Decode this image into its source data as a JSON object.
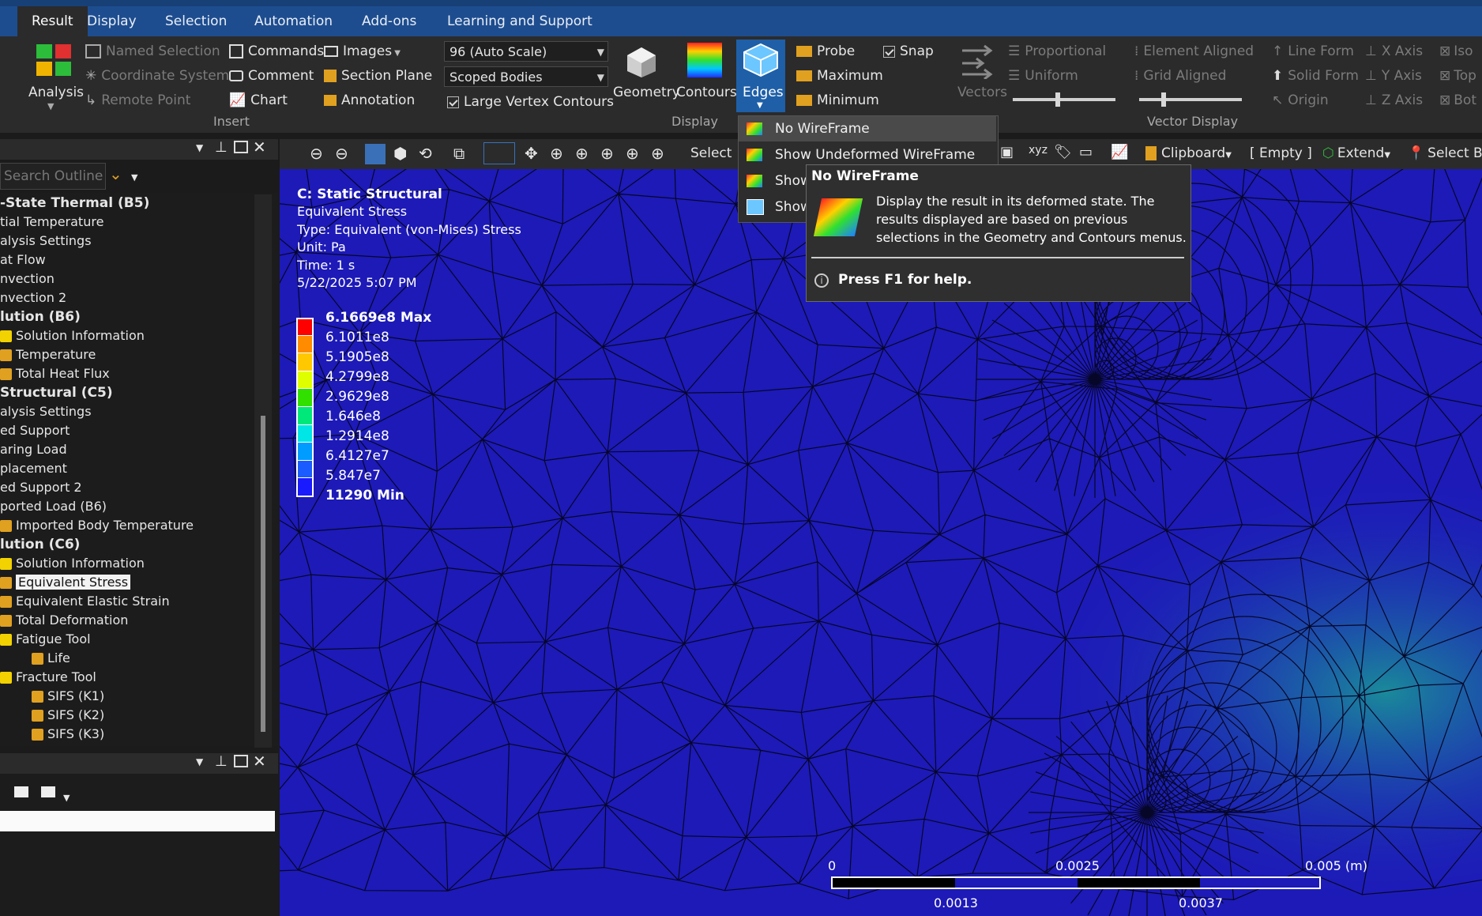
{
  "tabs": [
    {
      "label": "Result",
      "active": true
    },
    {
      "label": "Display",
      "active": false
    },
    {
      "label": "Selection",
      "active": false
    },
    {
      "label": "Automation",
      "active": false
    },
    {
      "label": "Add-ons",
      "active": false
    },
    {
      "label": "Learning and Support",
      "active": false
    }
  ],
  "ribbon": {
    "analysis_label": "Analysis",
    "insert": {
      "named_selection": "Named Selection",
      "coordinate_system": "Coordinate System",
      "remote_point": "Remote Point",
      "commands": "Commands",
      "comment": "Comment",
      "chart": "Chart",
      "images": "Images",
      "section_plane": "Section Plane",
      "annotation": "Annotation",
      "group_label": "Insert"
    },
    "display": {
      "scale_value": "96 (Auto Scale)",
      "scope_value": "Scoped Bodies",
      "large_vertex_contours": "Large Vertex Contours",
      "large_vertex_contours_checked": true,
      "geometry": "Geometry",
      "contours": "Contours",
      "edges": "Edges",
      "group_label": "Display"
    },
    "probe_group": {
      "probe": "Probe",
      "maximum": "Maximum",
      "minimum": "Minimum",
      "snap": "Snap",
      "snap_checked": true
    },
    "vector_display": {
      "vectors": "Vectors",
      "proportional": "Proportional",
      "uniform": "Uniform",
      "element_aligned": "Element Aligned",
      "grid_aligned": "Grid Aligned",
      "line_form": "Line Form",
      "solid_form": "Solid Form",
      "origin": "Origin",
      "x_axis": "X Axis",
      "y_axis": "Y Axis",
      "z_axis": "Z Axis",
      "iso": "Iso",
      "top": "Top",
      "bot": "Bot",
      "group_label": "Vector Display"
    }
  },
  "outline": {
    "search_placeholder": "Search Outline",
    "items": [
      {
        "label": "-State Thermal (B5)",
        "bold": true,
        "indent": 0,
        "icon": ""
      },
      {
        "label": "tial Temperature",
        "bold": false,
        "indent": 0,
        "icon": ""
      },
      {
        "label": "alysis Settings",
        "bold": false,
        "indent": 0,
        "icon": ""
      },
      {
        "label": "at Flow",
        "bold": false,
        "indent": 0,
        "icon": ""
      },
      {
        "label": "nvection",
        "bold": false,
        "indent": 0,
        "icon": ""
      },
      {
        "label": "nvection 2",
        "bold": false,
        "indent": 0,
        "icon": ""
      },
      {
        "label": "lution (B6)",
        "bold": true,
        "indent": 0,
        "icon": ""
      },
      {
        "label": "Solution Information",
        "bold": false,
        "indent": 0,
        "icon": "info"
      },
      {
        "label": "Temperature",
        "bold": false,
        "indent": 0,
        "icon": "result"
      },
      {
        "label": "Total Heat Flux",
        "bold": false,
        "indent": 0,
        "icon": "result"
      },
      {
        "label": "Structural (C5)",
        "bold": true,
        "indent": 0,
        "icon": ""
      },
      {
        "label": "alysis Settings",
        "bold": false,
        "indent": 0,
        "icon": ""
      },
      {
        "label": "ed Support",
        "bold": false,
        "indent": 0,
        "icon": ""
      },
      {
        "label": "aring Load",
        "bold": false,
        "indent": 0,
        "icon": ""
      },
      {
        "label": "placement",
        "bold": false,
        "indent": 0,
        "icon": ""
      },
      {
        "label": "ed Support 2",
        "bold": false,
        "indent": 0,
        "icon": ""
      },
      {
        "label": "ported Load (B6)",
        "bold": false,
        "indent": 0,
        "icon": ""
      },
      {
        "label": "Imported Body Temperature",
        "bold": false,
        "indent": 0,
        "icon": "result"
      },
      {
        "label": "lution (C6)",
        "bold": true,
        "indent": 0,
        "icon": ""
      },
      {
        "label": "Solution Information",
        "bold": false,
        "indent": 0,
        "icon": "info"
      },
      {
        "label": "Equivalent Stress",
        "bold": false,
        "indent": 0,
        "icon": "result",
        "selected": true
      },
      {
        "label": "Equivalent Elastic Strain",
        "bold": false,
        "indent": 0,
        "icon": "result"
      },
      {
        "label": "Total Deformation",
        "bold": false,
        "indent": 0,
        "icon": "result"
      },
      {
        "label": "Fatigue Tool",
        "bold": false,
        "indent": 0,
        "icon": "info"
      },
      {
        "label": "Life",
        "bold": false,
        "indent": 1,
        "icon": "result"
      },
      {
        "label": "Fracture Tool",
        "bold": false,
        "indent": 0,
        "icon": "info"
      },
      {
        "label": "SIFS (K1)",
        "bold": false,
        "indent": 1,
        "icon": "result"
      },
      {
        "label": "SIFS (K2)",
        "bold": false,
        "indent": 1,
        "icon": "result"
      },
      {
        "label": "SIFS (K3)",
        "bold": false,
        "indent": 1,
        "icon": "result"
      }
    ]
  },
  "viewport_toolbar": {
    "select": "Select",
    "clipboard": "Clipboard",
    "empty": "[ Empty ]",
    "extend": "Extend",
    "select_by": "Select By"
  },
  "edges_menu": {
    "items": [
      {
        "label": "No WireFrame",
        "highlighted": true
      },
      {
        "label": "Show Undeformed WireFrame",
        "highlighted": false
      },
      {
        "label": "Show",
        "highlighted": false
      },
      {
        "label": "Show",
        "highlighted": false
      }
    ]
  },
  "tooltip": {
    "title": "No WireFrame",
    "body_lines": [
      "Display the result in its deformed state. The",
      "results displayed are based on previous",
      "selections in the Geometry and Contours menus."
    ],
    "help": "Press F1 for help."
  },
  "viewport_info": {
    "lines": [
      "C: Static Structural",
      "Equivalent Stress",
      "Type: Equivalent (von-Mises) Stress",
      "Unit: Pa",
      "Time: 1 s",
      "5/22/2025 5:07 PM"
    ]
  },
  "legend": {
    "labels": [
      "6.1669e8 Max",
      "6.1011e8",
      "5.1905e8",
      "4.2799e8",
      "2.9629e8",
      "1.646e8",
      "1.2914e8",
      "6.4127e7",
      "5.847e7",
      "11290 Min"
    ],
    "colors": [
      "#ff0000",
      "#ff8c00",
      "#ffc800",
      "#dfff00",
      "#32e000",
      "#00e87a",
      "#00e6e6",
      "#009cff",
      "#1a5cff",
      "#1a1aff"
    ]
  },
  "scale_bar": {
    "top_labels": [
      "0",
      "0.0025",
      "0.005 (m)"
    ],
    "bottom_labels": [
      "0.0013",
      "0.0037"
    ]
  }
}
